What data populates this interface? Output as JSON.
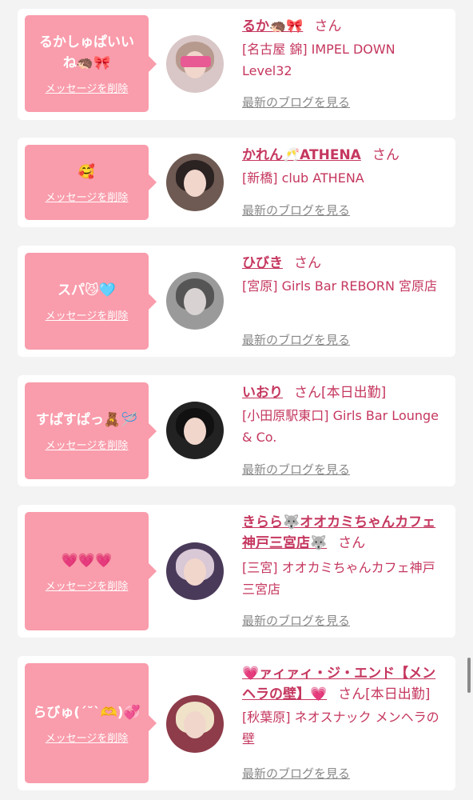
{
  "delete_label": "メッセージを削除",
  "blog_label": "最新のブログを見る",
  "san_label": "さん",
  "cards": [
    {
      "message": "るかしゅぱいいね🦔🎀",
      "name": "るか🦔🎀",
      "status": "",
      "shop": "[名古屋 錦] IMPEL DOWN Level32"
    },
    {
      "message": "🥰",
      "name": "かれん🥂ATHENA",
      "status": "",
      "shop": "[新橋] club ATHENA"
    },
    {
      "message": "スパ😼🩵",
      "name": "ひびき",
      "status": "",
      "shop": "[宮原] Girls Bar REBORN 宮原店"
    },
    {
      "message": "すぱすぱっ🧸🪡",
      "name": "いおり",
      "status": "[本日出勤]",
      "shop": "[小田原駅東口] Girls Bar Lounge & Co."
    },
    {
      "message": "💗💗💗",
      "name": "きらら🐺オオカミちゃんカフェ神戸三宮店🐺",
      "status": "",
      "shop": "[三宮] オオカミちゃんカフェ神戸三宮店"
    },
    {
      "message": "らびゅ(ˊ˘ˋ🫶)💞",
      "name": "💗ァィァィ・ジ・エンド【メンヘラの壁】💗",
      "status": "[本日出勤]",
      "shop": "[秋葉原] ネオスナック メンヘラの壁"
    }
  ],
  "colors": {
    "accent": "#c5375f",
    "bubble": "#f99cab",
    "link_gray": "#888888"
  }
}
